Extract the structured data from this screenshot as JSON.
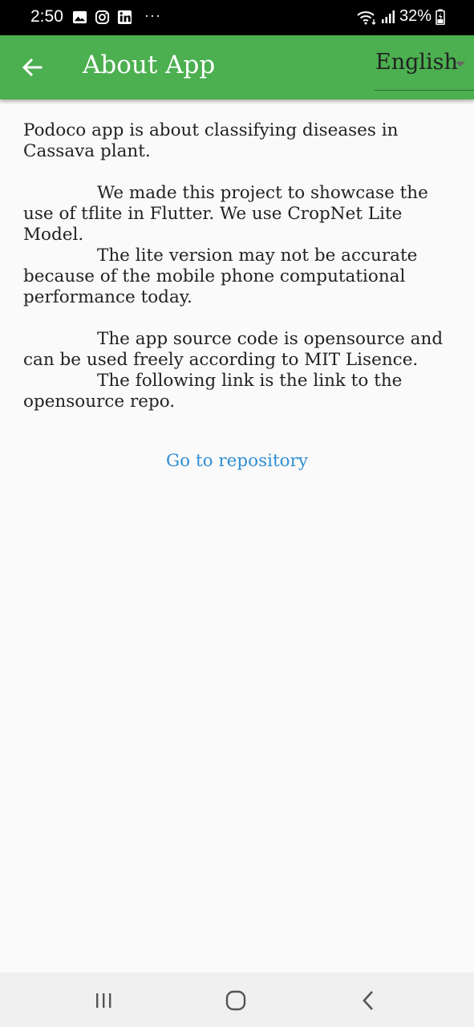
{
  "status_bar": {
    "time": "2:50",
    "battery": "32%",
    "icons": [
      "gallery-icon",
      "instagram-icon",
      "linkedin-icon",
      "more-icon",
      "wifi-icon",
      "signal-icon",
      "battery-icon"
    ],
    "more": "···"
  },
  "app_bar": {
    "title": "About App",
    "language": "English",
    "accent_color": "#4caf50"
  },
  "content": {
    "p1": "Podoco app is about classifying diseases in Cassava plant.",
    "p2a": "We made this project to showcase the use of tflite in Flutter. We use CropNet Lite Model.",
    "p2b": "The lite version may not be accurate because of the mobile phone computational performance today.",
    "p3a": "The app source code is opensource and can be used freely according to MIT Lisence.",
    "p3b": "The following link is the link to the opensource repo.",
    "link": "Go to repository",
    "link_color": "#2e8fd6"
  },
  "nav_bar": {
    "buttons": [
      "recents-icon",
      "home-icon",
      "back-icon"
    ]
  }
}
